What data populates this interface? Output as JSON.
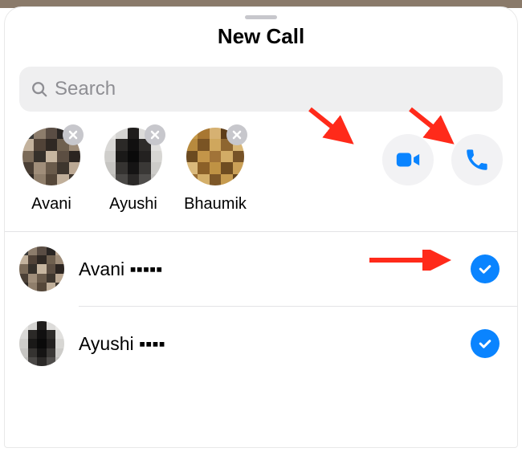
{
  "header": {
    "title": "New Call"
  },
  "search": {
    "placeholder": "Search",
    "value": ""
  },
  "selected": [
    {
      "name": "Avani"
    },
    {
      "name": "Ayushi"
    },
    {
      "name": "Bhaumik"
    }
  ],
  "contacts": [
    {
      "name": "Avani ▪▪▪▪▪",
      "selected": true
    },
    {
      "name": "Ayushi ▪▪▪▪",
      "selected": true
    }
  ],
  "colors": {
    "accent": "#0a84ff"
  }
}
